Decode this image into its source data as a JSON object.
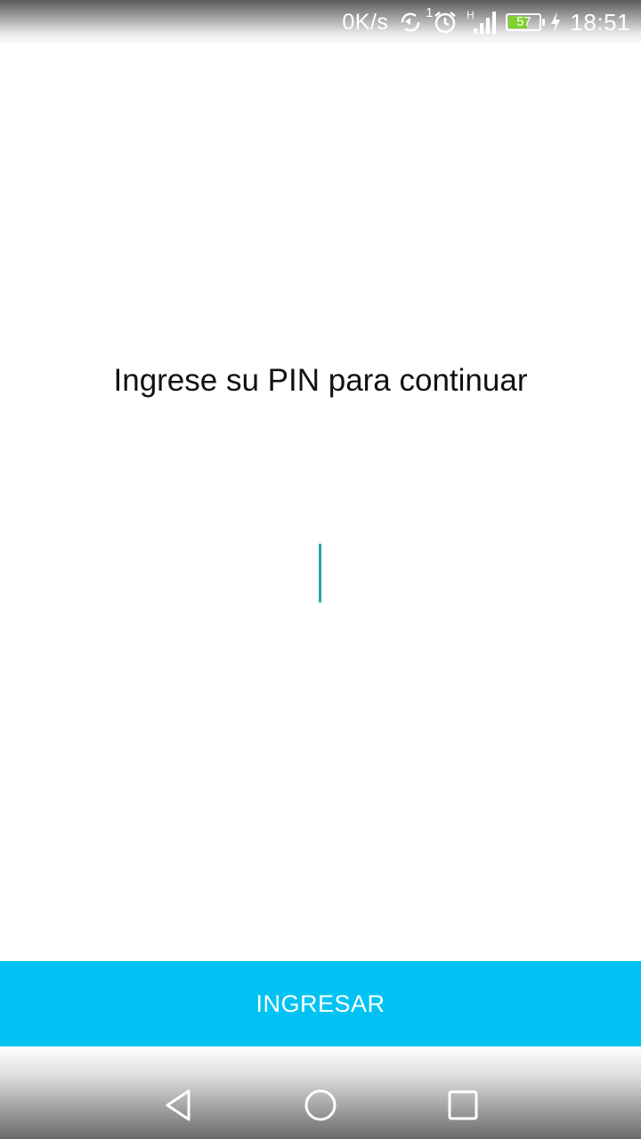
{
  "status_bar": {
    "net_speed": "0K/s",
    "sync_count": "1",
    "network_type": "H",
    "battery_level": "57",
    "time": "18:51",
    "icons": [
      "sync-icon",
      "alarm-icon",
      "signal-icon",
      "battery-icon",
      "charging-icon"
    ]
  },
  "main": {
    "prompt": "Ingrese su PIN para continuar",
    "pin_value": ""
  },
  "actions": {
    "submit_label": "INGRESAR"
  },
  "nav_bar": {
    "icons": [
      "back-icon",
      "home-icon",
      "recents-icon"
    ]
  },
  "colors": {
    "accent": "#00c3f3",
    "caret": "#26a3b9",
    "text": "#111111",
    "battery_fill": "#7ed12a"
  }
}
